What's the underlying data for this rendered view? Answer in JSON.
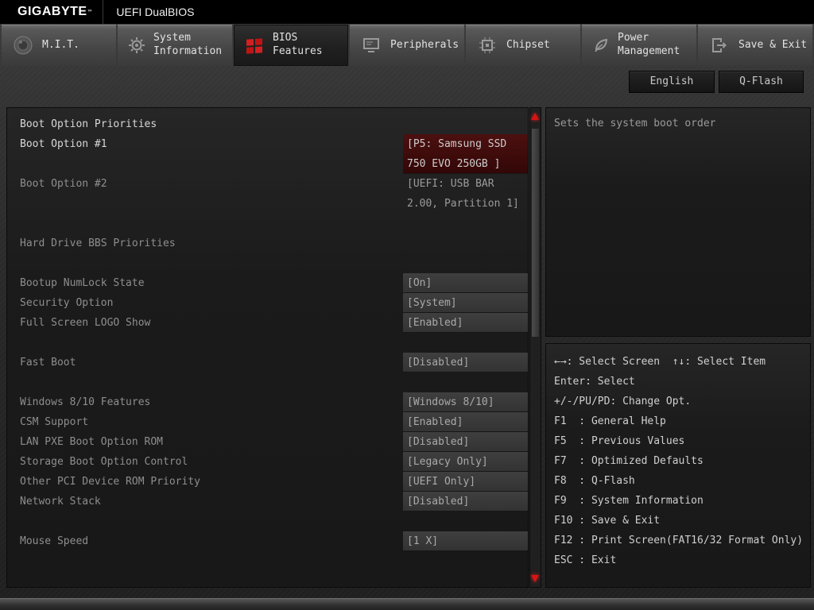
{
  "header": {
    "brand": "GIGABYTE",
    "trademark": "™",
    "title": "UEFI DualBIOS"
  },
  "tabs": [
    {
      "label": "M.I.T.",
      "active": false
    },
    {
      "label": "System Information",
      "active": false
    },
    {
      "label": "BIOS Features",
      "active": true
    },
    {
      "label": "Peripherals",
      "active": false
    },
    {
      "label": "Chipset",
      "active": false
    },
    {
      "label": "Power Management",
      "active": false
    },
    {
      "label": "Save & Exit",
      "active": false
    }
  ],
  "toolbar": {
    "language_button": "English",
    "qflash_button": "Q-Flash"
  },
  "settings": {
    "rows": [
      {
        "label": "Boot Option Priorities",
        "type": "section-header"
      },
      {
        "label": "Boot Option #1",
        "value": "[P5: Samsung SSD 750 EVO 250GB ]",
        "selected": true
      },
      {
        "label": "Boot Option #2",
        "value": "[UEFI: USB BAR 2.00, Partition 1]"
      },
      {
        "label": "Hard Drive BBS Priorities"
      },
      {
        "label": "Bootup NumLock State",
        "value": "[On]"
      },
      {
        "label": "Security Option",
        "value": "[System]"
      },
      {
        "label": "Full Screen LOGO Show",
        "value": "[Enabled]"
      },
      {
        "label": "Fast Boot",
        "value": "[Disabled]"
      },
      {
        "label": "Windows 8/10 Features",
        "value": "[Windows 8/10]"
      },
      {
        "label": "CSM Support",
        "value": "[Enabled]"
      },
      {
        "label": "LAN PXE Boot Option ROM",
        "value": "[Disabled]"
      },
      {
        "label": "Storage Boot Option Control",
        "value": "[Legacy Only]"
      },
      {
        "label": "Other PCI Device ROM Priority",
        "value": "[UEFI Only]"
      },
      {
        "label": "Network Stack",
        "value": "[Disabled]"
      },
      {
        "label": "Mouse Speed",
        "value": "[1 X]"
      }
    ]
  },
  "help": {
    "description": "Sets the system boot order",
    "keys": [
      "←→: Select Screen  ↑↓: Select Item",
      "Enter: Select",
      "+/-/PU/PD: Change Opt.",
      "F1  : General Help",
      "F5  : Previous Values",
      "F7  : Optimized Defaults",
      "F8  : Q-Flash",
      "F9  : System Information",
      "F10 : Save & Exit",
      "F12 : Print Screen(FAT16/32 Format Only)",
      "ESC : Exit"
    ]
  }
}
